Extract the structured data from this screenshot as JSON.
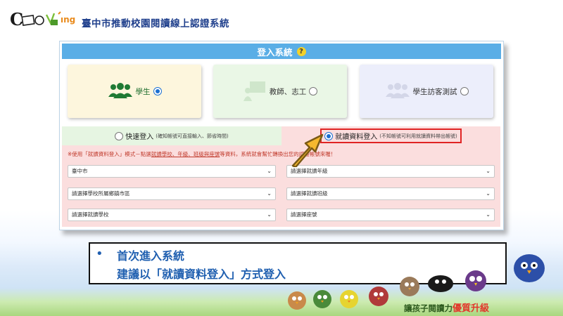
{
  "header": {
    "logo_text": "Coming",
    "title": "臺中市推動校園閱讀線上認證系統"
  },
  "login": {
    "title": "登入系統",
    "help_glyph": "?",
    "roles": [
      {
        "label": "學生",
        "selected": true
      },
      {
        "label": "教師、志工",
        "selected": false
      },
      {
        "label": "學生訪客測試",
        "selected": false
      }
    ],
    "modes": {
      "quick": {
        "label": "快速登入",
        "note": "(確知帳號可直接輸入、節省時間)",
        "selected": false
      },
      "school": {
        "label": "就讀資料登入",
        "note": "(不知帳號可利用就讀資料帶出帳號)",
        "selected": true
      }
    },
    "notice": {
      "prefix": "※使用「就讀資料登入」模式－點選",
      "underlined": "就讀學校、年級、班級與座號",
      "suffix": "等資料，系統就會幫忙轉換出您的認證帳號來喔！"
    },
    "selects": {
      "city": "臺中市",
      "district": "請選擇學校所屬鄉鎮市區",
      "school": "請選擇就讀學校",
      "grade": "請選擇就讀年級",
      "class": "請選擇就讀班級",
      "seat": "請選擇座號"
    }
  },
  "callout": {
    "bullet": "•",
    "line1": "首次進入系統",
    "line2": "建議以「就讀資料登入」方式登入"
  },
  "footer": {
    "slogan_main": "讓孩子閱讀力",
    "slogan_highlight": "優質升級"
  },
  "colors": {
    "header_bar": "#5aaee6",
    "title_blue": "#1f3f8c",
    "highlight_red": "#e02424",
    "arrow": "#f5b82e"
  }
}
